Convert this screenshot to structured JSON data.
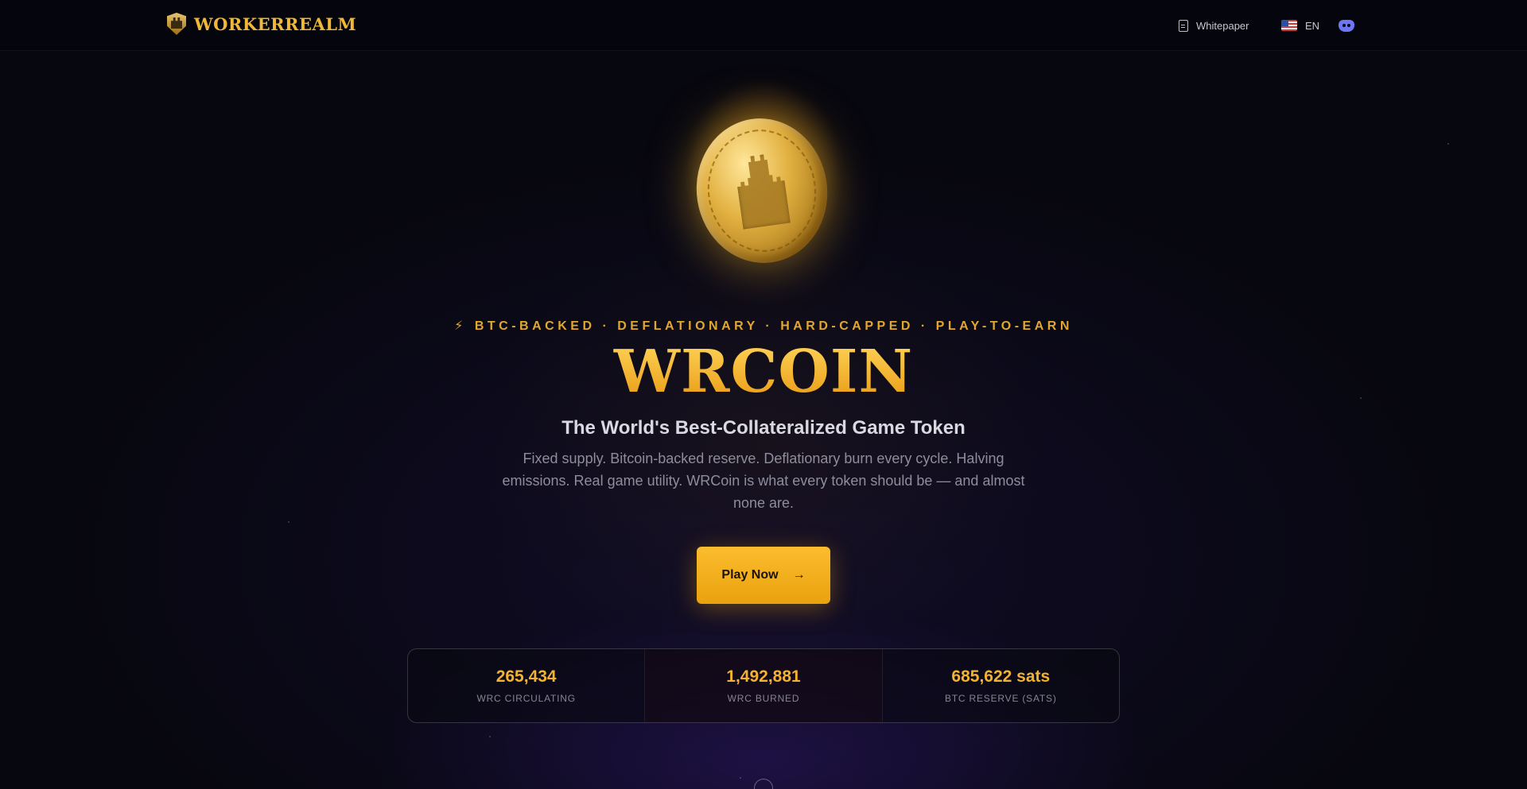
{
  "header": {
    "brand": "WORKERREALM",
    "nav": {
      "whitepaper": "Whitepaper",
      "language": "EN"
    }
  },
  "hero": {
    "tagline": "BTC-BACKED · DEFLATIONARY · HARD-CAPPED · PLAY-TO-EARN",
    "title": "WRCOIN",
    "subtitle": "The World's Best-Collateralized Game Token",
    "description": "Fixed supply. Bitcoin-backed reserve. Deflationary burn every cycle. Halving emissions. Real game utility. WRCoin is what every token should be — and almost none are.",
    "cta_label": "Play Now"
  },
  "stats": [
    {
      "value": "265,434",
      "label": "WRC CIRCULATING"
    },
    {
      "value": "1,492,881",
      "label": "WRC BURNED"
    },
    {
      "value": "685,622 sats",
      "label": "BTC RESERVE (SATS)"
    }
  ],
  "icons": {
    "logo": "castle-shield-icon",
    "whitepaper": "document-icon",
    "language": "us-flag-icon",
    "discord": "discord-icon",
    "tagline": "lightning-bolt-icon",
    "cta": "arrow-right-icon",
    "coin": "castle-coin-image"
  },
  "colors": {
    "accent": "#f3b232",
    "background": "#07070f",
    "discord": "#6d76f4"
  }
}
